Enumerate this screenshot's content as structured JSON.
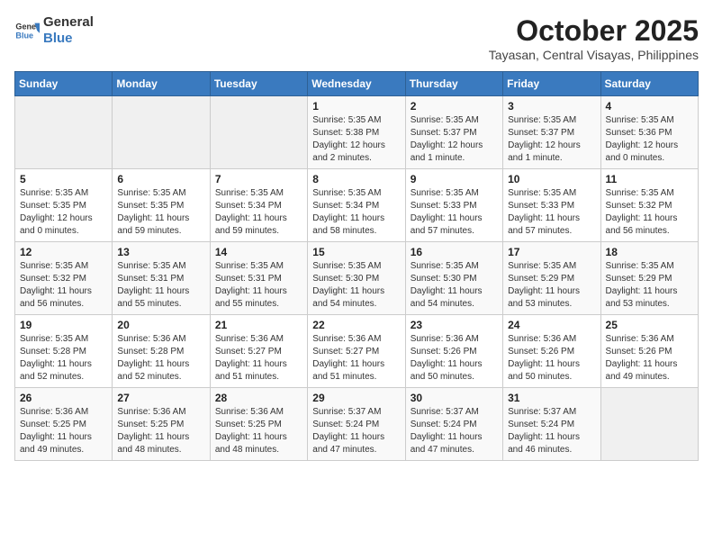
{
  "header": {
    "logo_line1": "General",
    "logo_line2": "Blue",
    "month": "October 2025",
    "location": "Tayasan, Central Visayas, Philippines"
  },
  "weekdays": [
    "Sunday",
    "Monday",
    "Tuesday",
    "Wednesday",
    "Thursday",
    "Friday",
    "Saturday"
  ],
  "weeks": [
    [
      {
        "day": "",
        "info": ""
      },
      {
        "day": "",
        "info": ""
      },
      {
        "day": "",
        "info": ""
      },
      {
        "day": "1",
        "info": "Sunrise: 5:35 AM\nSunset: 5:38 PM\nDaylight: 12 hours\nand 2 minutes."
      },
      {
        "day": "2",
        "info": "Sunrise: 5:35 AM\nSunset: 5:37 PM\nDaylight: 12 hours\nand 1 minute."
      },
      {
        "day": "3",
        "info": "Sunrise: 5:35 AM\nSunset: 5:37 PM\nDaylight: 12 hours\nand 1 minute."
      },
      {
        "day": "4",
        "info": "Sunrise: 5:35 AM\nSunset: 5:36 PM\nDaylight: 12 hours\nand 0 minutes."
      }
    ],
    [
      {
        "day": "5",
        "info": "Sunrise: 5:35 AM\nSunset: 5:35 PM\nDaylight: 12 hours\nand 0 minutes."
      },
      {
        "day": "6",
        "info": "Sunrise: 5:35 AM\nSunset: 5:35 PM\nDaylight: 11 hours\nand 59 minutes."
      },
      {
        "day": "7",
        "info": "Sunrise: 5:35 AM\nSunset: 5:34 PM\nDaylight: 11 hours\nand 59 minutes."
      },
      {
        "day": "8",
        "info": "Sunrise: 5:35 AM\nSunset: 5:34 PM\nDaylight: 11 hours\nand 58 minutes."
      },
      {
        "day": "9",
        "info": "Sunrise: 5:35 AM\nSunset: 5:33 PM\nDaylight: 11 hours\nand 57 minutes."
      },
      {
        "day": "10",
        "info": "Sunrise: 5:35 AM\nSunset: 5:33 PM\nDaylight: 11 hours\nand 57 minutes."
      },
      {
        "day": "11",
        "info": "Sunrise: 5:35 AM\nSunset: 5:32 PM\nDaylight: 11 hours\nand 56 minutes."
      }
    ],
    [
      {
        "day": "12",
        "info": "Sunrise: 5:35 AM\nSunset: 5:32 PM\nDaylight: 11 hours\nand 56 minutes."
      },
      {
        "day": "13",
        "info": "Sunrise: 5:35 AM\nSunset: 5:31 PM\nDaylight: 11 hours\nand 55 minutes."
      },
      {
        "day": "14",
        "info": "Sunrise: 5:35 AM\nSunset: 5:31 PM\nDaylight: 11 hours\nand 55 minutes."
      },
      {
        "day": "15",
        "info": "Sunrise: 5:35 AM\nSunset: 5:30 PM\nDaylight: 11 hours\nand 54 minutes."
      },
      {
        "day": "16",
        "info": "Sunrise: 5:35 AM\nSunset: 5:30 PM\nDaylight: 11 hours\nand 54 minutes."
      },
      {
        "day": "17",
        "info": "Sunrise: 5:35 AM\nSunset: 5:29 PM\nDaylight: 11 hours\nand 53 minutes."
      },
      {
        "day": "18",
        "info": "Sunrise: 5:35 AM\nSunset: 5:29 PM\nDaylight: 11 hours\nand 53 minutes."
      }
    ],
    [
      {
        "day": "19",
        "info": "Sunrise: 5:35 AM\nSunset: 5:28 PM\nDaylight: 11 hours\nand 52 minutes."
      },
      {
        "day": "20",
        "info": "Sunrise: 5:36 AM\nSunset: 5:28 PM\nDaylight: 11 hours\nand 52 minutes."
      },
      {
        "day": "21",
        "info": "Sunrise: 5:36 AM\nSunset: 5:27 PM\nDaylight: 11 hours\nand 51 minutes."
      },
      {
        "day": "22",
        "info": "Sunrise: 5:36 AM\nSunset: 5:27 PM\nDaylight: 11 hours\nand 51 minutes."
      },
      {
        "day": "23",
        "info": "Sunrise: 5:36 AM\nSunset: 5:26 PM\nDaylight: 11 hours\nand 50 minutes."
      },
      {
        "day": "24",
        "info": "Sunrise: 5:36 AM\nSunset: 5:26 PM\nDaylight: 11 hours\nand 50 minutes."
      },
      {
        "day": "25",
        "info": "Sunrise: 5:36 AM\nSunset: 5:26 PM\nDaylight: 11 hours\nand 49 minutes."
      }
    ],
    [
      {
        "day": "26",
        "info": "Sunrise: 5:36 AM\nSunset: 5:25 PM\nDaylight: 11 hours\nand 49 minutes."
      },
      {
        "day": "27",
        "info": "Sunrise: 5:36 AM\nSunset: 5:25 PM\nDaylight: 11 hours\nand 48 minutes."
      },
      {
        "day": "28",
        "info": "Sunrise: 5:36 AM\nSunset: 5:25 PM\nDaylight: 11 hours\nand 48 minutes."
      },
      {
        "day": "29",
        "info": "Sunrise: 5:37 AM\nSunset: 5:24 PM\nDaylight: 11 hours\nand 47 minutes."
      },
      {
        "day": "30",
        "info": "Sunrise: 5:37 AM\nSunset: 5:24 PM\nDaylight: 11 hours\nand 47 minutes."
      },
      {
        "day": "31",
        "info": "Sunrise: 5:37 AM\nSunset: 5:24 PM\nDaylight: 11 hours\nand 46 minutes."
      },
      {
        "day": "",
        "info": ""
      }
    ]
  ]
}
